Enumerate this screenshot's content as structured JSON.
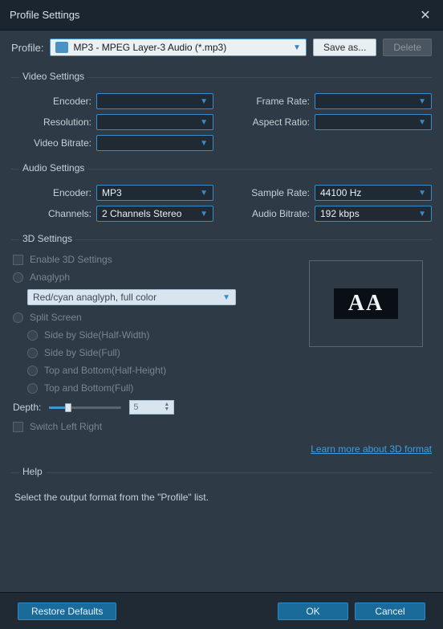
{
  "title": "Profile Settings",
  "profile": {
    "label": "Profile:",
    "selected": "MP3 - MPEG Layer-3 Audio (*.mp3)",
    "save_as": "Save as...",
    "delete": "Delete"
  },
  "video": {
    "legend": "Video Settings",
    "encoder_label": "Encoder:",
    "encoder": "",
    "resolution_label": "Resolution:",
    "resolution": "",
    "video_bitrate_label": "Video Bitrate:",
    "video_bitrate": "",
    "frame_rate_label": "Frame Rate:",
    "frame_rate": "",
    "aspect_ratio_label": "Aspect Ratio:",
    "aspect_ratio": ""
  },
  "audio": {
    "legend": "Audio Settings",
    "encoder_label": "Encoder:",
    "encoder": "MP3",
    "channels_label": "Channels:",
    "channels": "2 Channels Stereo",
    "sample_rate_label": "Sample Rate:",
    "sample_rate": "44100 Hz",
    "audio_bitrate_label": "Audio Bitrate:",
    "audio_bitrate": "192 kbps"
  },
  "threed": {
    "legend": "3D Settings",
    "enable": "Enable 3D Settings",
    "anaglyph": "Anaglyph",
    "anaglyph_select": "Red/cyan anaglyph, full color",
    "split_screen": "Split Screen",
    "sbs_half": "Side by Side(Half-Width)",
    "sbs_full": "Side by Side(Full)",
    "tab_half": "Top and Bottom(Half-Height)",
    "tab_full": "Top and Bottom(Full)",
    "depth_label": "Depth:",
    "depth_value": "5",
    "switch_lr": "Switch Left Right",
    "learn_more": "Learn more about 3D format",
    "preview": "AA"
  },
  "help": {
    "legend": "Help",
    "text": "Select the output format from the \"Profile\" list."
  },
  "footer": {
    "restore": "Restore Defaults",
    "ok": "OK",
    "cancel": "Cancel"
  }
}
